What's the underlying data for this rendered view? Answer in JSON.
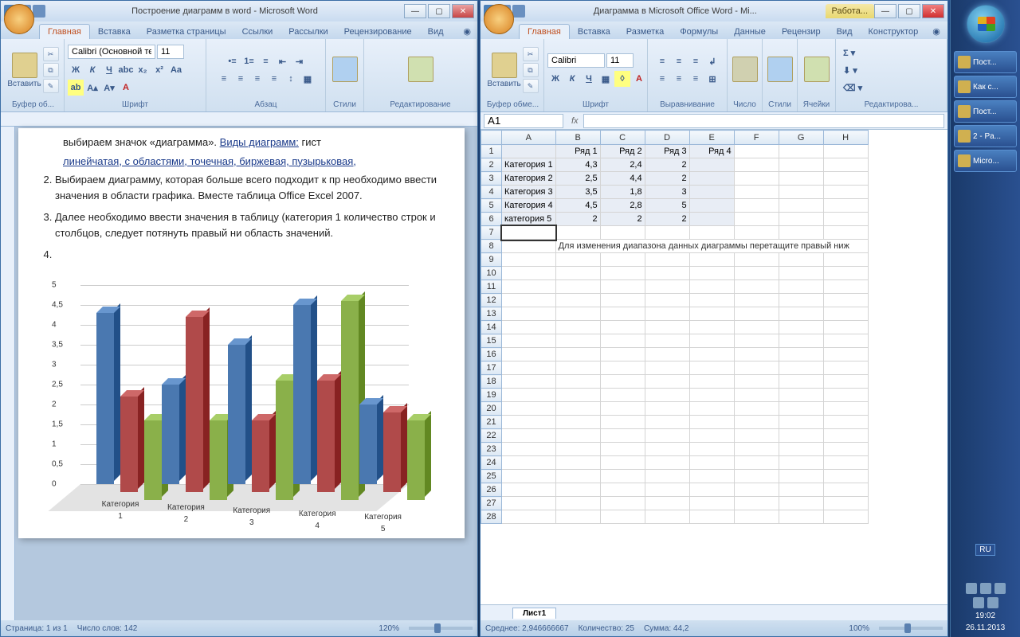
{
  "word": {
    "title": "Построение диаграмм в word - Microsoft Word",
    "tabs": [
      "Главная",
      "Вставка",
      "Разметка страницы",
      "Ссылки",
      "Рассылки",
      "Рецензирование",
      "Вид"
    ],
    "groups": {
      "clipboard": "Буфер об...",
      "paste": "Вставить",
      "font": "Шрифт",
      "para": "Абзац",
      "styles": "Стили",
      "editing": "Редактирование"
    },
    "font_name": "Calibri (Основной те",
    "font_size": "11",
    "doc": {
      "p1": "выбираем значок «диаграмма». ",
      "p1_link": "Виды диаграмм:",
      "p1_tail": " гист",
      "p1b": "линейчатая, с областями, точечная, биржевая, пузырьковая, ",
      "li2": "Выбираем диаграмму, которая больше всего подходит к пр необходимо ввести значения в области графика. Вместе таблица Office Excel 2007.",
      "li3": "Далее необходимо ввести значения в таблицу (категория 1 количество строк и столбцов, следует потянуть правый ни область значений.",
      "li4": ""
    },
    "status": {
      "page": "Страница: 1 из 1",
      "words": "Число слов: 142",
      "zoom": "120%"
    }
  },
  "excel": {
    "title": "Диаграмма в Microsoft Office Word - Mi...",
    "context_tab": "Работа...",
    "tabs": [
      "Главная",
      "Вставка",
      "Разметка",
      "Формулы",
      "Данные",
      "Рецензир",
      "Вид",
      "Конструктор"
    ],
    "groups": {
      "clipboard": "Буфер обме...",
      "paste": "Вставить",
      "font": "Шрифт",
      "align": "Выравнивание",
      "number": "Число",
      "styles": "Стили",
      "cells": "Ячейки",
      "editing": "Редактирова..."
    },
    "font_name": "Calibri",
    "font_size": "11",
    "namebox": "A1",
    "fx": "fx",
    "cols": [
      "A",
      "B",
      "C",
      "D",
      "E",
      "F",
      "G",
      "H"
    ],
    "headers": [
      "",
      "Ряд 1",
      "Ряд 2",
      "Ряд 3",
      "Ряд 4"
    ],
    "rows": [
      [
        "Категория 1",
        "4,3",
        "2,4",
        "2",
        ""
      ],
      [
        "Категория 2",
        "2,5",
        "4,4",
        "2",
        ""
      ],
      [
        "Категория 3",
        "3,5",
        "1,8",
        "3",
        ""
      ],
      [
        "Категория 4",
        "4,5",
        "2,8",
        "5",
        ""
      ],
      [
        "категория 5",
        "2",
        "2",
        "2",
        ""
      ]
    ],
    "hint": "Для изменения диапазона данных диаграммы перетащите правый ниж",
    "sheet_tab": "Лист1",
    "status": {
      "avg": "Среднее: 2,946666667",
      "count": "Количество: 25",
      "sum": "Сумма: 44,2",
      "zoom": "100%"
    }
  },
  "taskbar": {
    "items": [
      "Пост...",
      "Как с...",
      "Пост...",
      "2 - Pa...",
      "Micro..."
    ],
    "lang": "RU",
    "time": "19:02",
    "date": "26.11.2013"
  },
  "chart_data": {
    "type": "bar",
    "title": "",
    "categories": [
      "Категория 1",
      "Категория 2",
      "Категория 3",
      "Категория 4",
      "категория 5"
    ],
    "series": [
      {
        "name": "Ряд 1",
        "values": [
          4.3,
          2.5,
          3.5,
          4.5,
          2
        ],
        "color": "#4a78b0"
      },
      {
        "name": "Ряд 2",
        "values": [
          2.4,
          4.4,
          1.8,
          2.8,
          2
        ],
        "color": "#b04a4a"
      },
      {
        "name": "Ряд 3",
        "values": [
          2,
          2,
          3,
          5,
          2
        ],
        "color": "#8ab04a"
      }
    ],
    "ylim": [
      0,
      5
    ],
    "yticks": [
      0,
      0.5,
      1,
      1.5,
      2,
      2.5,
      3,
      3.5,
      4,
      4.5,
      5
    ],
    "xlabel": "",
    "ylabel": ""
  }
}
